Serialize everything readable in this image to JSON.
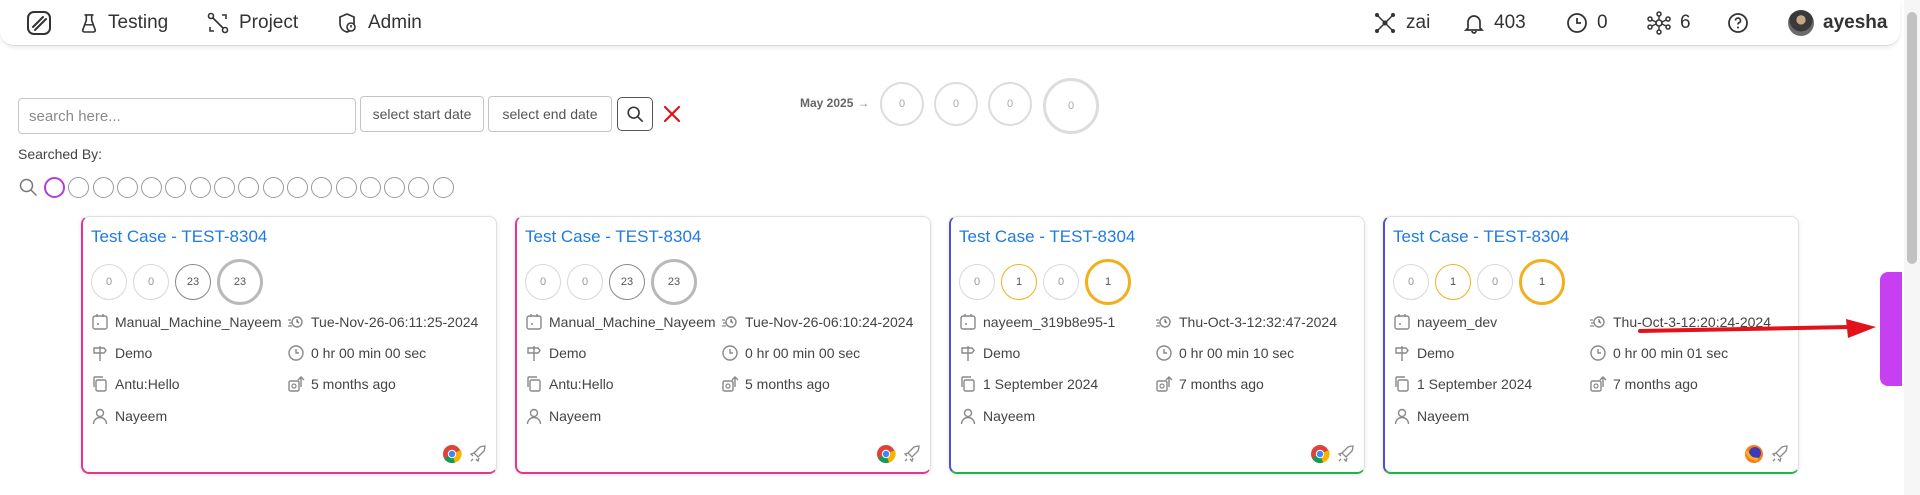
{
  "nav": {
    "left": [
      {
        "label": "Testing",
        "icon": "flask-icon"
      },
      {
        "label": "Project",
        "icon": "project-icon"
      },
      {
        "label": "Admin",
        "icon": "admin-shield-icon"
      }
    ],
    "right": {
      "zai_label": "zai",
      "notifications": "403",
      "clock_count": "0",
      "network_count": "6",
      "username": "ayesha"
    }
  },
  "search": {
    "placeholder": "search here...",
    "start_date": "select start date",
    "end_date": "select end date",
    "searched_by": "Searched By:"
  },
  "filters": {
    "count": 17,
    "active_index": 0
  },
  "month": {
    "label": "May 2025",
    "arrow": "→",
    "values": [
      "0",
      "0",
      "0",
      "0"
    ]
  },
  "cards": [
    {
      "title": "Test Case - TEST-8304",
      "circles": [
        "0",
        "0",
        "23",
        "23"
      ],
      "machine": "Manual_Machine_Nayeem",
      "timestamp": "Tue-Nov-26-06:11:25-2024",
      "environment": "Demo",
      "duration": "0 hr 00 min 00 sec",
      "build": "Antu:Hello",
      "ago": "5 months ago",
      "user": "Nayeem",
      "browser": "chrome",
      "accent": "#e8338f"
    },
    {
      "title": "Test Case - TEST-8304",
      "circles": [
        "0",
        "0",
        "23",
        "23"
      ],
      "machine": "Manual_Machine_Nayeem",
      "timestamp": "Tue-Nov-26-06:10:24-2024",
      "environment": "Demo",
      "duration": "0 hr 00 min 00 sec",
      "build": "Antu:Hello",
      "ago": "5 months ago",
      "user": "Nayeem",
      "browser": "chrome",
      "accent": "#e8338f"
    },
    {
      "title": "Test Case - TEST-8304",
      "circles": [
        "0",
        "1",
        "0",
        "1"
      ],
      "machine": "nayeem_319b8e95-1",
      "timestamp": "Thu-Oct-3-12:32:47-2024",
      "environment": "Demo",
      "duration": "0 hr 00 min 10 sec",
      "build": "1 September 2024",
      "ago": "7 months ago",
      "user": "Nayeem",
      "browser": "chrome",
      "accent": "#22b24c"
    },
    {
      "title": "Test Case - TEST-8304",
      "circles": [
        "0",
        "1",
        "0",
        "1"
      ],
      "machine": "nayeem_dev",
      "timestamp": "Thu-Oct-3-12:20:24-2024",
      "environment": "Demo",
      "duration": "0 hr 00 min 01 sec",
      "build": "1 September 2024",
      "ago": "7 months ago",
      "user": "Nayeem",
      "browser": "firefox",
      "accent": "#22b24c"
    }
  ],
  "colors": {
    "link": "#1e7be0",
    "pink": "#e8338f",
    "green": "#22b24c",
    "yellow": "#f2b01e",
    "purple": "#c640f2",
    "red": "#e3111a"
  }
}
